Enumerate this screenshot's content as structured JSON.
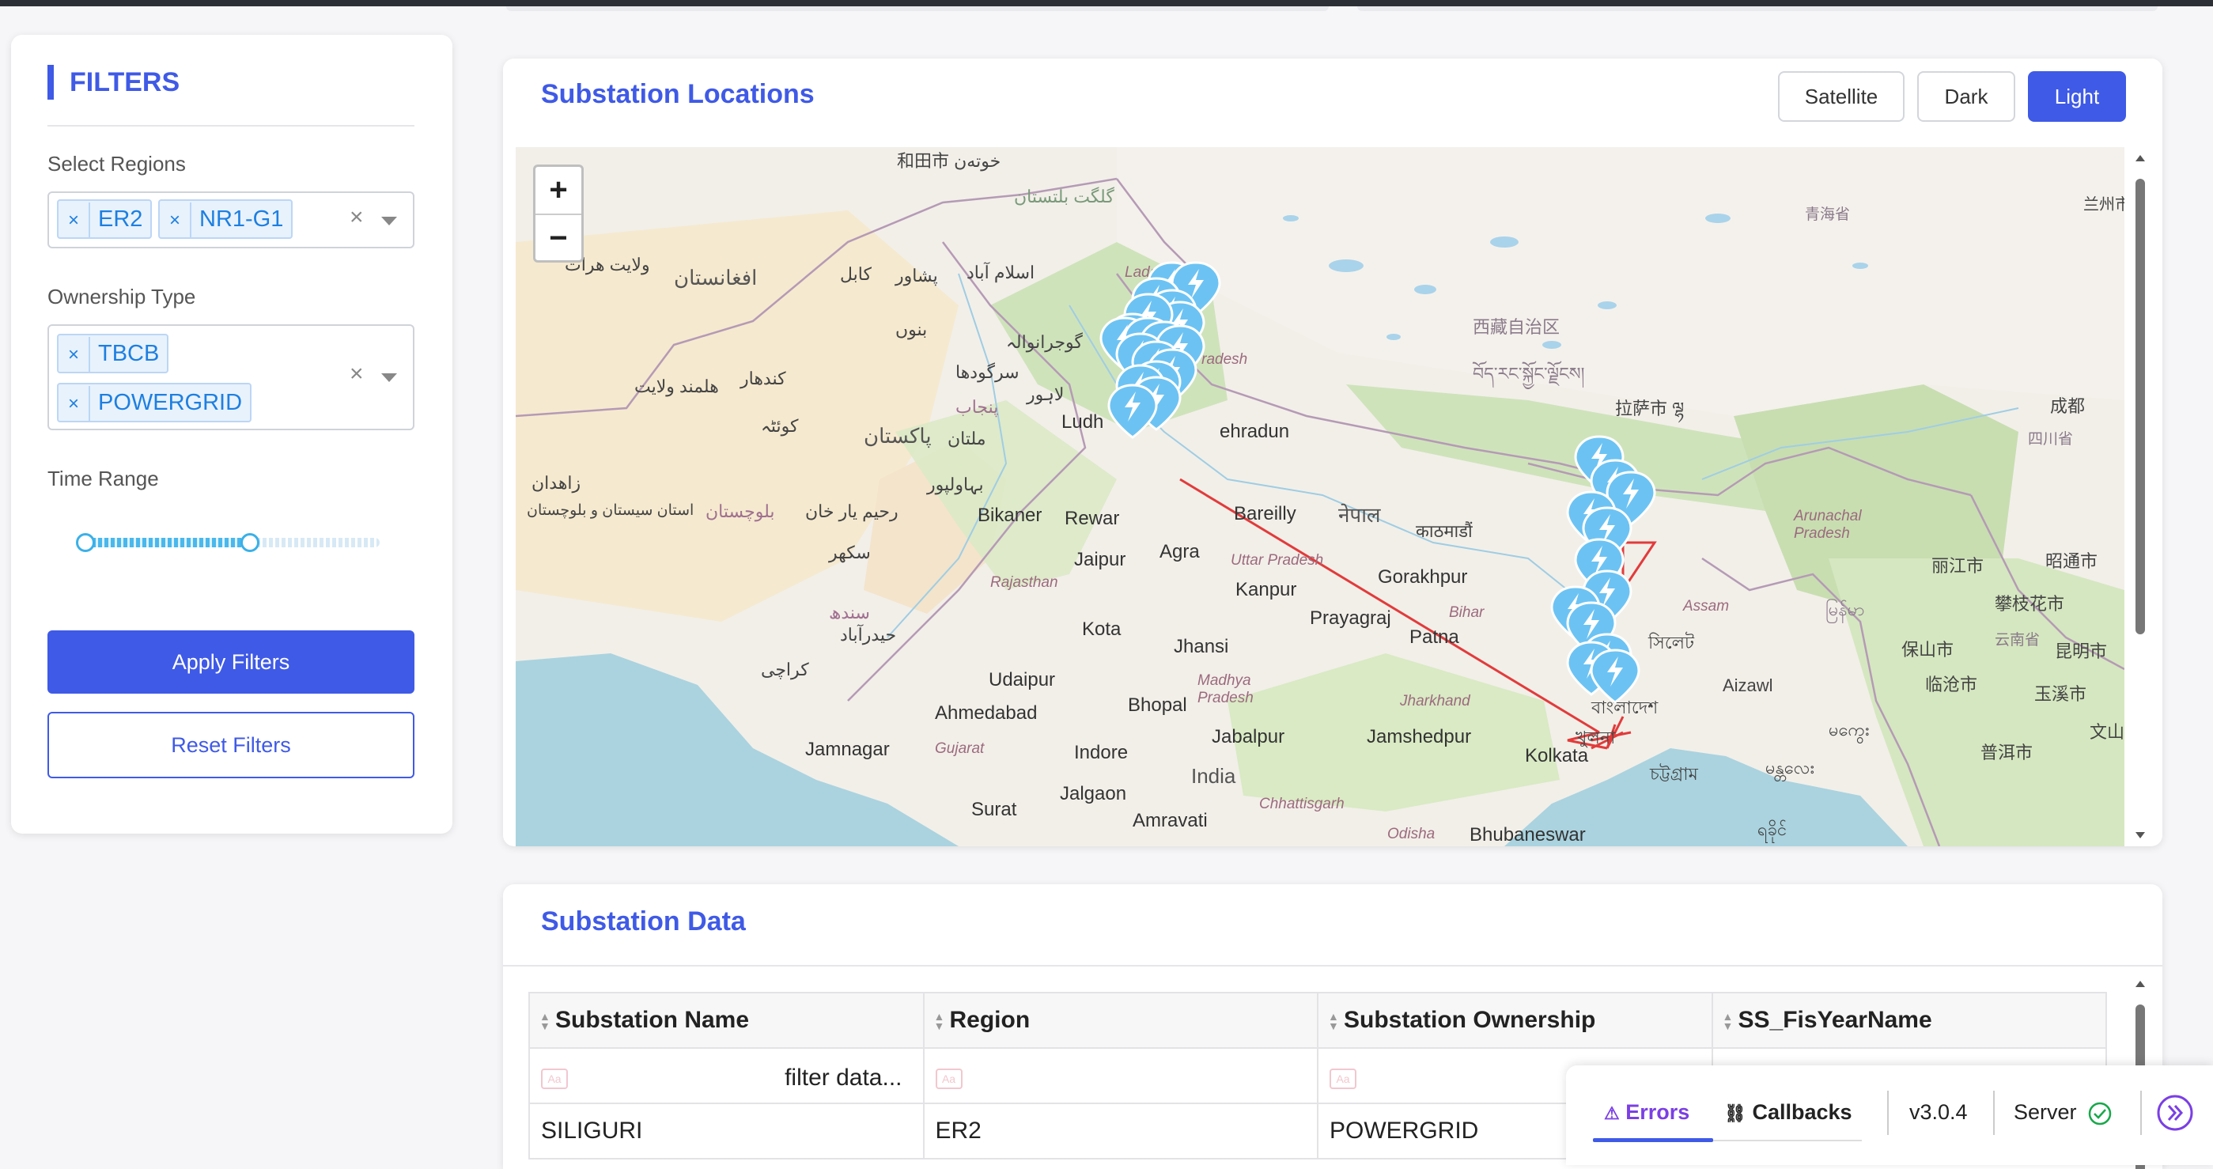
{
  "filters": {
    "title": "FILTERS",
    "regions": {
      "label": "Select Regions",
      "selected": [
        "ER2",
        "NR1-G1"
      ]
    },
    "ownership": {
      "label": "Ownership Type",
      "selected": [
        "TBCB",
        "POWERGRID"
      ]
    },
    "time_range": {
      "label": "Time Range",
      "start_fraction": 0.0,
      "end_fraction": 0.56
    },
    "apply_label": "Apply Filters",
    "reset_label": "Reset Filters",
    "remove_glyph": "×",
    "clear_glyph": "×"
  },
  "map": {
    "title": "Substation Locations",
    "layers": [
      "Satellite",
      "Dark",
      "Light"
    ],
    "active_layer": "Light",
    "zoom_in": "+",
    "zoom_out": "−",
    "labels": {
      "hotan": "和田市 خوتەن",
      "gilgit": "گلگت بلتستان",
      "afghanistan": "افغانستان",
      "kabul": "کابل",
      "peshawar": "پشاور",
      "islamabad": "اسلام آباد",
      "herat": "ولایت هرات",
      "bannu": "بنوں",
      "gujranwala": "گوجرانوالہ",
      "sargodha": "سرگودھا",
      "punjab_pk": "پنجاب",
      "lahore": "لاہور",
      "kandahar": "کندهار",
      "helmand": "هلمند ولايت",
      "quetta": "کوئٹہ",
      "pakistan": "پاکستان",
      "multan": "ملتان",
      "bahawalpur": "بہاولپور",
      "zahedan": "زاهدان",
      "sistan": "استان سیستان و بلوچستان",
      "balochistan": "بلوچستان",
      "rahim_yar_khan": "رحیم یار خان",
      "sukkur": "سکھر",
      "sindh": "سندھ",
      "hyderabad": "حیدرآباد",
      "karachi": "کراچی",
      "ladakh": "Ladakh",
      "himachal": "Himachal Pradesh",
      "ludhiana": "Ludh",
      "dehradun": "ehradun",
      "bikaner": "Bikaner",
      "rewari": "Rewar",
      "jaipur": "Jaipur",
      "agra": "Agra",
      "bareilly": "Bareilly",
      "rajasthan": "Rajasthan",
      "uttar_pradesh": "Uttar Pradesh",
      "kanpur": "Kanpur",
      "kota": "Kota",
      "jhansi": "Jhansi",
      "prayagraj": "Prayagraj",
      "gorakhpur": "Gorakhpur",
      "patna": "Patna",
      "bihar": "Bihar",
      "udaipur": "Udaipur",
      "ahmedabad": "Ahmedabad",
      "madhya_pradesh": "Madhya Pradesh",
      "bhopal": "Bhopal",
      "jharkhand": "Jharkhand",
      "jamnagar": "Jamnagar",
      "gujarat": "Gujarat",
      "indore": "Indore",
      "jabalpur": "Jabalpur",
      "jamshedpur": "Jamshedpur",
      "kolkata": "Kolkata",
      "india": "India",
      "surat": "Surat",
      "jalgaon": "Jalgaon",
      "amravati": "Amravati",
      "chhattisgarh": "Chhattisgarh",
      "odisha": "Odisha",
      "bhubaneswar": "Bhubaneswar",
      "nepal": "नेपाल",
      "kathmandu": "काठमाडौं",
      "xizang": "西藏自治区",
      "bod": "བོད་རང་སྐྱོང་ལྗོངས།",
      "lhasa": "拉萨市 ལྷ",
      "qinghai": "青海省",
      "chengdu": "成都",
      "sichuan": "四川省",
      "lanzhou": "兰州市",
      "arunachal": "Arunachal Pradesh",
      "assam": "Assam",
      "sylhet": "সিলেট",
      "bangladesh": "বাংলাদেশ",
      "khulna": "খুলনা",
      "chattogram": "চট্টগ্রাম",
      "aizawl": "Aizawl",
      "myanmar": "မြန်မာ",
      "lijiang": "丽江市",
      "zhaotong": "昭通市",
      "panzhihua": "攀枝花市",
      "yunnan": "云南省",
      "kunming": "昆明市",
      "baoshan": "保山市",
      "lincang": "临沧市",
      "yuxi": "玉溪市",
      "puer": "普洱市",
      "ziyang": "文山",
      "mandalay": "မန္တလေး",
      "rakhine": "ရခိုင်",
      "magway": "မကွေး"
    }
  },
  "table": {
    "title": "Substation Data",
    "columns": [
      "Substation Name",
      "Region",
      "Substation Ownership",
      "SS_FisYearName"
    ],
    "filter_placeholder": "filter data...",
    "case_badge": "Aa",
    "rows": [
      [
        "SILIGURI",
        "ER2",
        "POWERGRID",
        ""
      ]
    ]
  },
  "dash_debug": {
    "errors_label": "Errors",
    "callbacks_label": "Callbacks",
    "version": "v3.0.4",
    "server_label": "Server"
  },
  "colors": {
    "accent": "#3f5ae6",
    "chip_text": "#1d7fe0",
    "marker": "#6cc3f3",
    "connection_line": "#e23b3b"
  }
}
